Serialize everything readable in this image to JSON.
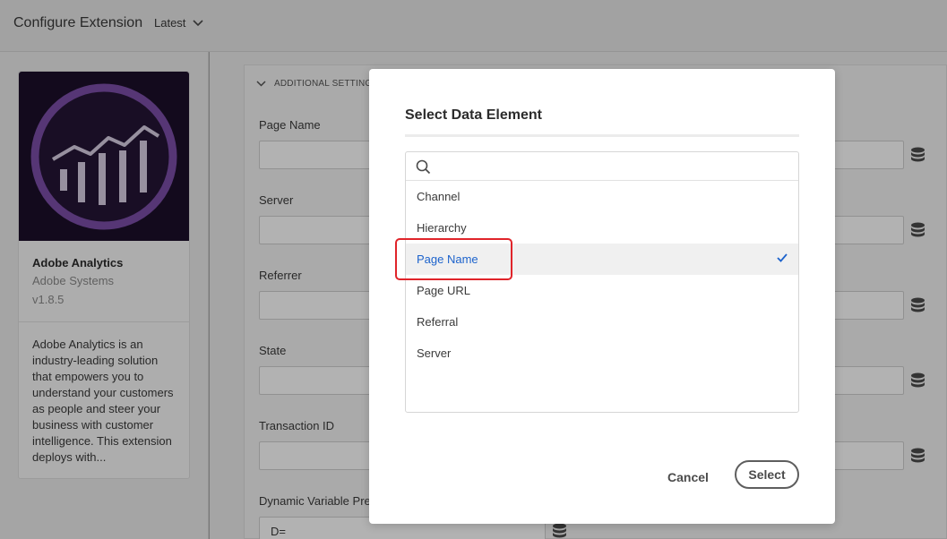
{
  "header": {
    "title": "Configure Extension",
    "version": "Latest"
  },
  "extension": {
    "name": "Adobe Analytics",
    "vendor": "Adobe Systems",
    "version": "v1.8.5",
    "description": "Adobe Analytics is an industry-leading solution that empowers you to understand your customers as people and steer your business with customer intelligence. This extension deploys with..."
  },
  "settings": {
    "section_title": "ADDITIONAL SETTINGS",
    "fields": [
      {
        "label": "Page Name",
        "value": ""
      },
      {
        "label": "Server",
        "value": ""
      },
      {
        "label": "Referrer",
        "value": ""
      },
      {
        "label": "State",
        "value": ""
      },
      {
        "label": "Transaction ID",
        "value": ""
      },
      {
        "label": "Dynamic Variable Prefix",
        "value": "D="
      }
    ]
  },
  "modal": {
    "title": "Select Data Element",
    "search": {
      "value": "",
      "placeholder": ""
    },
    "items": [
      {
        "label": "Channel",
        "selected": false
      },
      {
        "label": "Hierarchy",
        "selected": false
      },
      {
        "label": "Page Name",
        "selected": true
      },
      {
        "label": "Page URL",
        "selected": false
      },
      {
        "label": "Referral",
        "selected": false
      },
      {
        "label": "Server",
        "selected": false
      }
    ],
    "cancel_label": "Cancel",
    "select_label": "Select"
  },
  "colors": {
    "selected_text": "#1d63cc",
    "highlight": "#e0242a",
    "logo_purple": "#7b4ea8"
  },
  "icons": [
    "chevron-down-icon",
    "database-icon",
    "search-icon",
    "checkmark-icon"
  ]
}
